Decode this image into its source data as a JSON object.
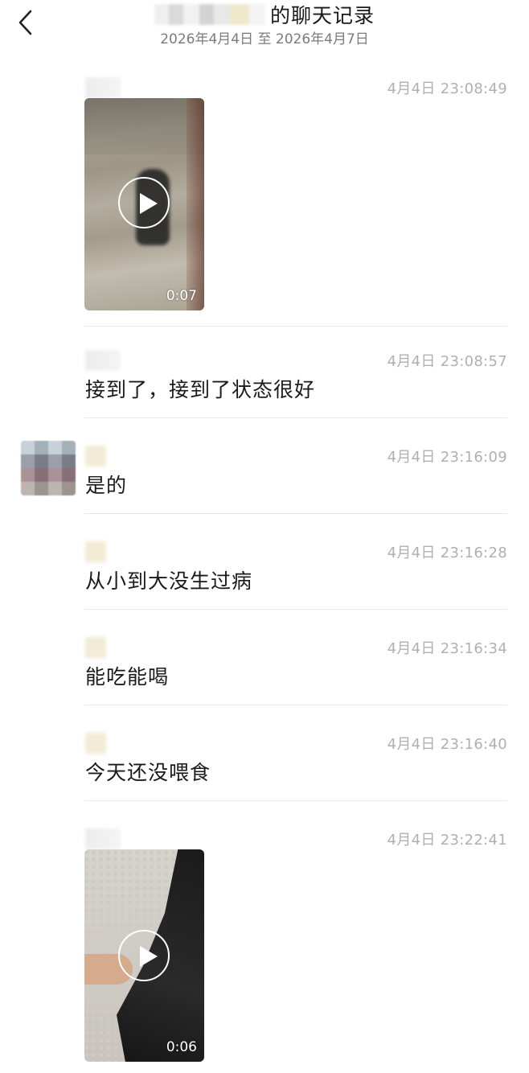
{
  "header": {
    "title_suffix": "的聊天记录",
    "date_range": "2026年4月4日 至 2026年4月7日"
  },
  "messages": [
    {
      "type": "video",
      "time": "4月4日 23:08:49",
      "duration": "0:07"
    },
    {
      "type": "text",
      "time": "4月4日 23:08:57",
      "text": "接到了，接到了状态很好"
    },
    {
      "type": "text",
      "time": "4月4日 23:16:09",
      "text": "是的"
    },
    {
      "type": "text",
      "time": "4月4日 23:16:28",
      "text": "从小到大没生过病"
    },
    {
      "type": "text",
      "time": "4月4日 23:16:34",
      "text": "能吃能喝"
    },
    {
      "type": "text",
      "time": "4月4日 23:16:40",
      "text": "今天还没喂食"
    },
    {
      "type": "video",
      "time": "4月4日 23:22:41",
      "duration": "0:06"
    }
  ],
  "icons": {
    "back": "chevron-left-icon",
    "play": "play-icon"
  },
  "colors": {
    "timestamp": "#b0b0b0",
    "subtitle": "#7b7b7b",
    "divider": "#e8e8e8"
  }
}
